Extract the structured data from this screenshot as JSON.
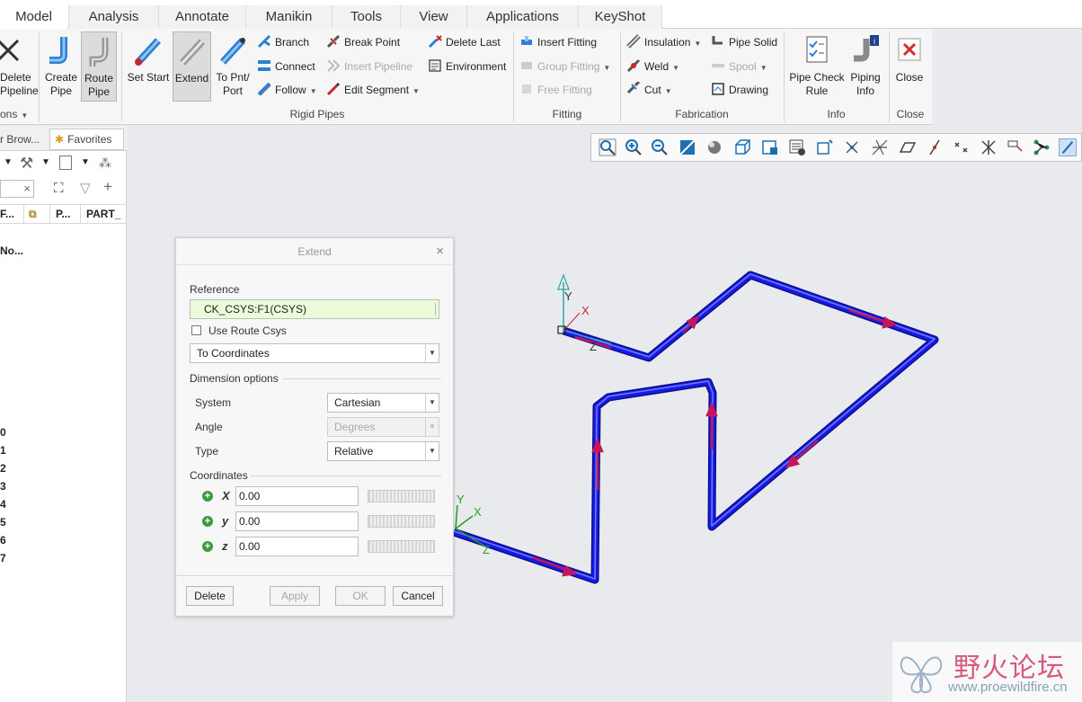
{
  "tabs": [
    "Model",
    "Analysis",
    "Annotate",
    "Manikin",
    "Tools",
    "View",
    "Applications",
    "KeyShot"
  ],
  "ribbon": {
    "delete_pipeline": "Delete\nPipeline",
    "create_pipe": "Create\nPipe",
    "route_pipe": "Route\nPipe",
    "set_start": "Set Start",
    "extend": "Extend",
    "to_pnt_port": "To Pnt/\nPort",
    "branch": "Branch",
    "connect": "Connect",
    "follow": "Follow",
    "break_point": "Break Point",
    "insert_pipeline": "Insert Pipeline",
    "edit_segment": "Edit Segment",
    "delete_last": "Delete Last",
    "environment": "Environment",
    "insert_fitting": "Insert Fitting",
    "group_fitting": "Group Fitting",
    "free_fitting": "Free Fitting",
    "insulation": "Insulation",
    "weld": "Weld",
    "cut": "Cut",
    "pipe_solid": "Pipe Solid",
    "spool": "Spool",
    "drawing": "Drawing",
    "pipe_check_rule": "Pipe Check\nRule",
    "piping_info": "Piping\nInfo",
    "close": "Close",
    "groups": {
      "ons": "ons",
      "rigid_pipes": "Rigid Pipes",
      "fitting": "Fitting",
      "fabrication": "Fabrication",
      "info": "Info",
      "close": "Close"
    }
  },
  "left_panel": {
    "tab_browser": "r Brow...",
    "tab_favorites": "Favorites",
    "col1": "F...",
    "col2": "P...",
    "col3": "PART_",
    "row_label": "No...",
    "numbers": [
      "0",
      "1",
      "2",
      "3",
      "4",
      "5",
      "6",
      "7"
    ]
  },
  "dialog": {
    "title": "Extend",
    "reference_label": "Reference",
    "reference_value": "CK_CSYS:F1(CSYS)",
    "use_route_csys": "Use Route Csys",
    "mode": "To Coordinates",
    "dimension_options": "Dimension options",
    "system_label": "System",
    "system_value": "Cartesian",
    "angle_label": "Angle",
    "angle_value": "Degrees",
    "type_label": "Type",
    "type_value": "Relative",
    "coordinates_label": "Coordinates",
    "x_label": "X",
    "y_label": "y",
    "z_label": "z",
    "x_value": "0.00",
    "y_value": "0.00",
    "z_value": "0.00",
    "delete": "Delete",
    "apply": "Apply",
    "ok": "OK",
    "cancel": "Cancel"
  },
  "viewport": {
    "axis_y": "Y",
    "axis_x": "X",
    "axis_z": "Z",
    "pipe_color": "#1a1ae6",
    "arrow_color": "#c2185b"
  },
  "watermark": {
    "text": "野火论坛",
    "url": "www.proewildfire.cn"
  }
}
